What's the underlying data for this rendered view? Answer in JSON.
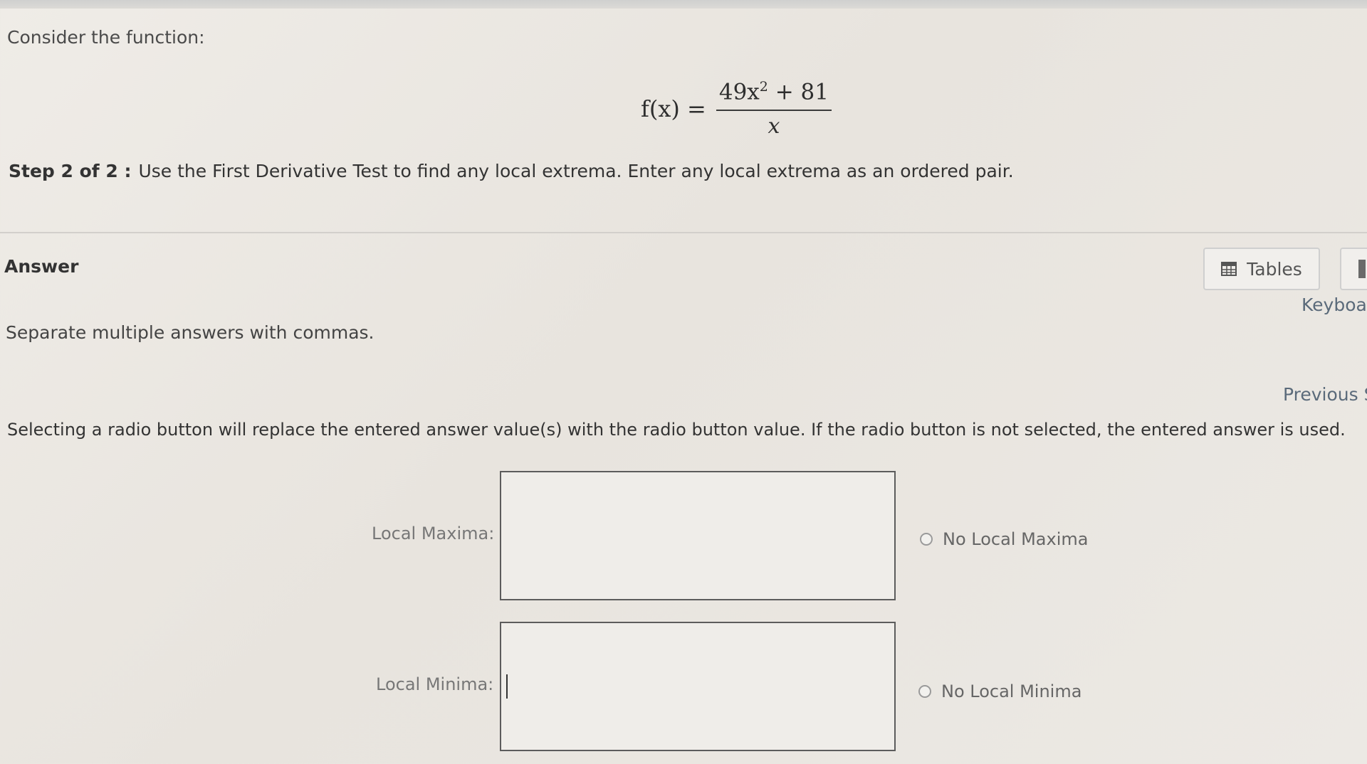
{
  "question": {
    "intro": "Consider the function:",
    "formula": {
      "lhs": "f(x) =",
      "numerator_base": "49x",
      "numerator_exponent": "2",
      "numerator_rest": " + 81",
      "denominator": "x"
    },
    "step_label": "Step 2 of 2 :",
    "step_text": "Use the First Derivative Test to find any local extrema. Enter any local extrema as an ordered pair."
  },
  "answer": {
    "title": "Answer",
    "tables_label": "Tables",
    "keyboard_label": "Keyboa",
    "separate_note": "Separate multiple answers with commas.",
    "previous_label": "Previous S",
    "radio_note": "Selecting a radio button will replace the entered answer value(s) with the radio button value. If the radio button is not selected, the entered answer is used.",
    "local_maxima": {
      "label": "Local Maxima:",
      "value": "",
      "radio_label": "No Local Maxima",
      "radio_selected": false
    },
    "local_minima": {
      "label": "Local Minima:",
      "value": "",
      "radio_label": "No Local Minima",
      "radio_selected": false
    }
  },
  "icons": {
    "tables": "table-grid-icon",
    "keyboard": "keyboard-icon"
  }
}
